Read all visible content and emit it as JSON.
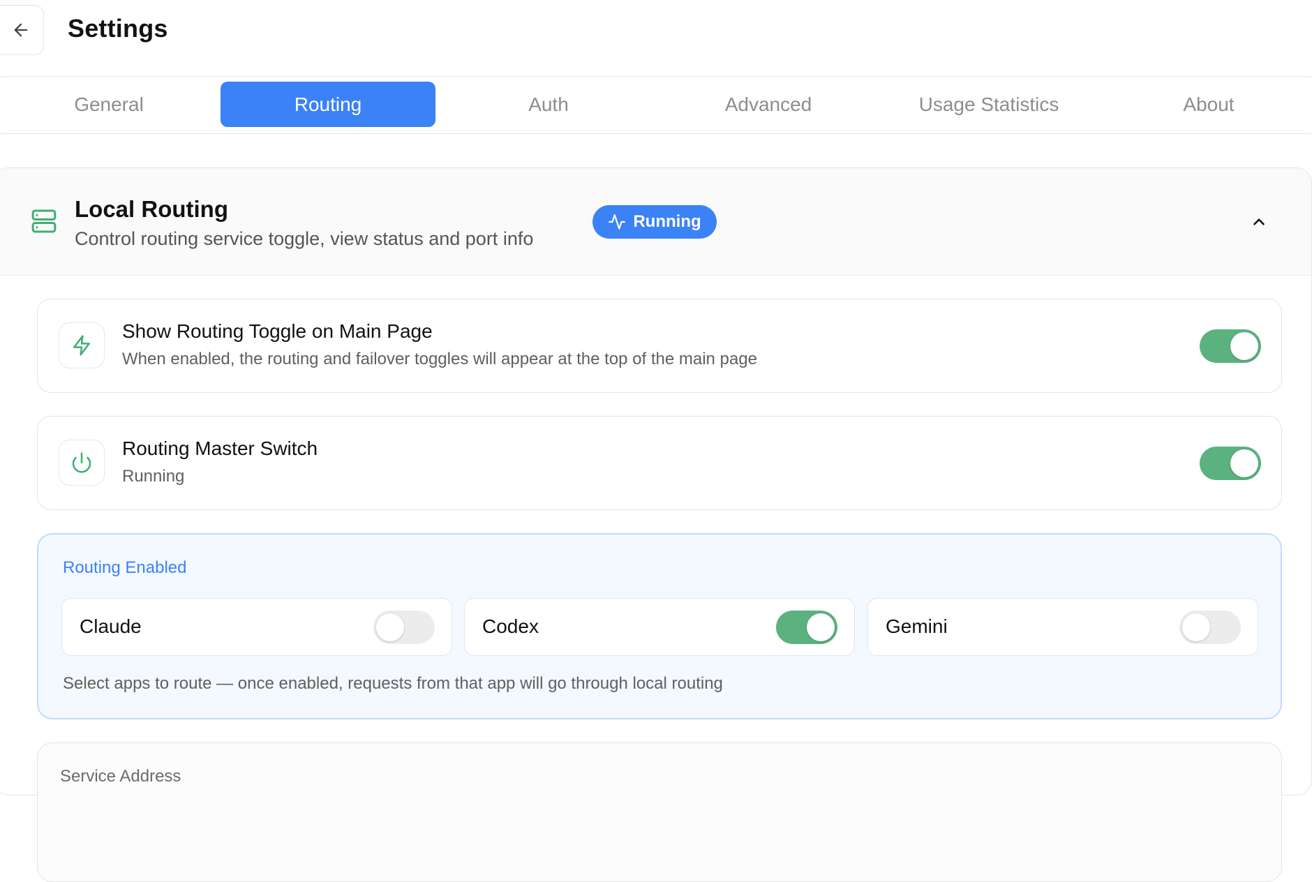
{
  "header": {
    "title": "Settings",
    "back_icon": "arrow-left-icon"
  },
  "tabs": [
    {
      "label": "General",
      "active": false
    },
    {
      "label": "Routing",
      "active": true
    },
    {
      "label": "Auth",
      "active": false
    },
    {
      "label": "Advanced",
      "active": false
    },
    {
      "label": "Usage Statistics",
      "active": false
    },
    {
      "label": "About",
      "active": false
    }
  ],
  "local_routing": {
    "title": "Local Routing",
    "subtitle": "Control routing service toggle, view status and port info",
    "icon": "server-icon",
    "status": {
      "label": "Running",
      "icon": "activity-icon"
    },
    "expanded": true,
    "settings": [
      {
        "title": "Show Routing Toggle on Main Page",
        "description": "When enabled, the routing and failover toggles will appear at the top of the main page",
        "icon": "lightning-icon",
        "enabled": true
      },
      {
        "title": "Routing Master Switch",
        "description": "Running",
        "icon": "power-icon",
        "enabled": true
      }
    ],
    "apps": {
      "label": "Routing Enabled",
      "items": [
        {
          "name": "Claude",
          "enabled": false
        },
        {
          "name": "Codex",
          "enabled": true
        },
        {
          "name": "Gemini",
          "enabled": false
        }
      ],
      "hint": "Select apps to route — once enabled, requests from that app will go through local routing"
    },
    "service": {
      "label": "Service Address"
    }
  },
  "colors": {
    "accent": "#3b82f6",
    "toggle_on": "#5bb27f",
    "toggle_off": "#ececec",
    "icon_green": "#3fae74"
  }
}
